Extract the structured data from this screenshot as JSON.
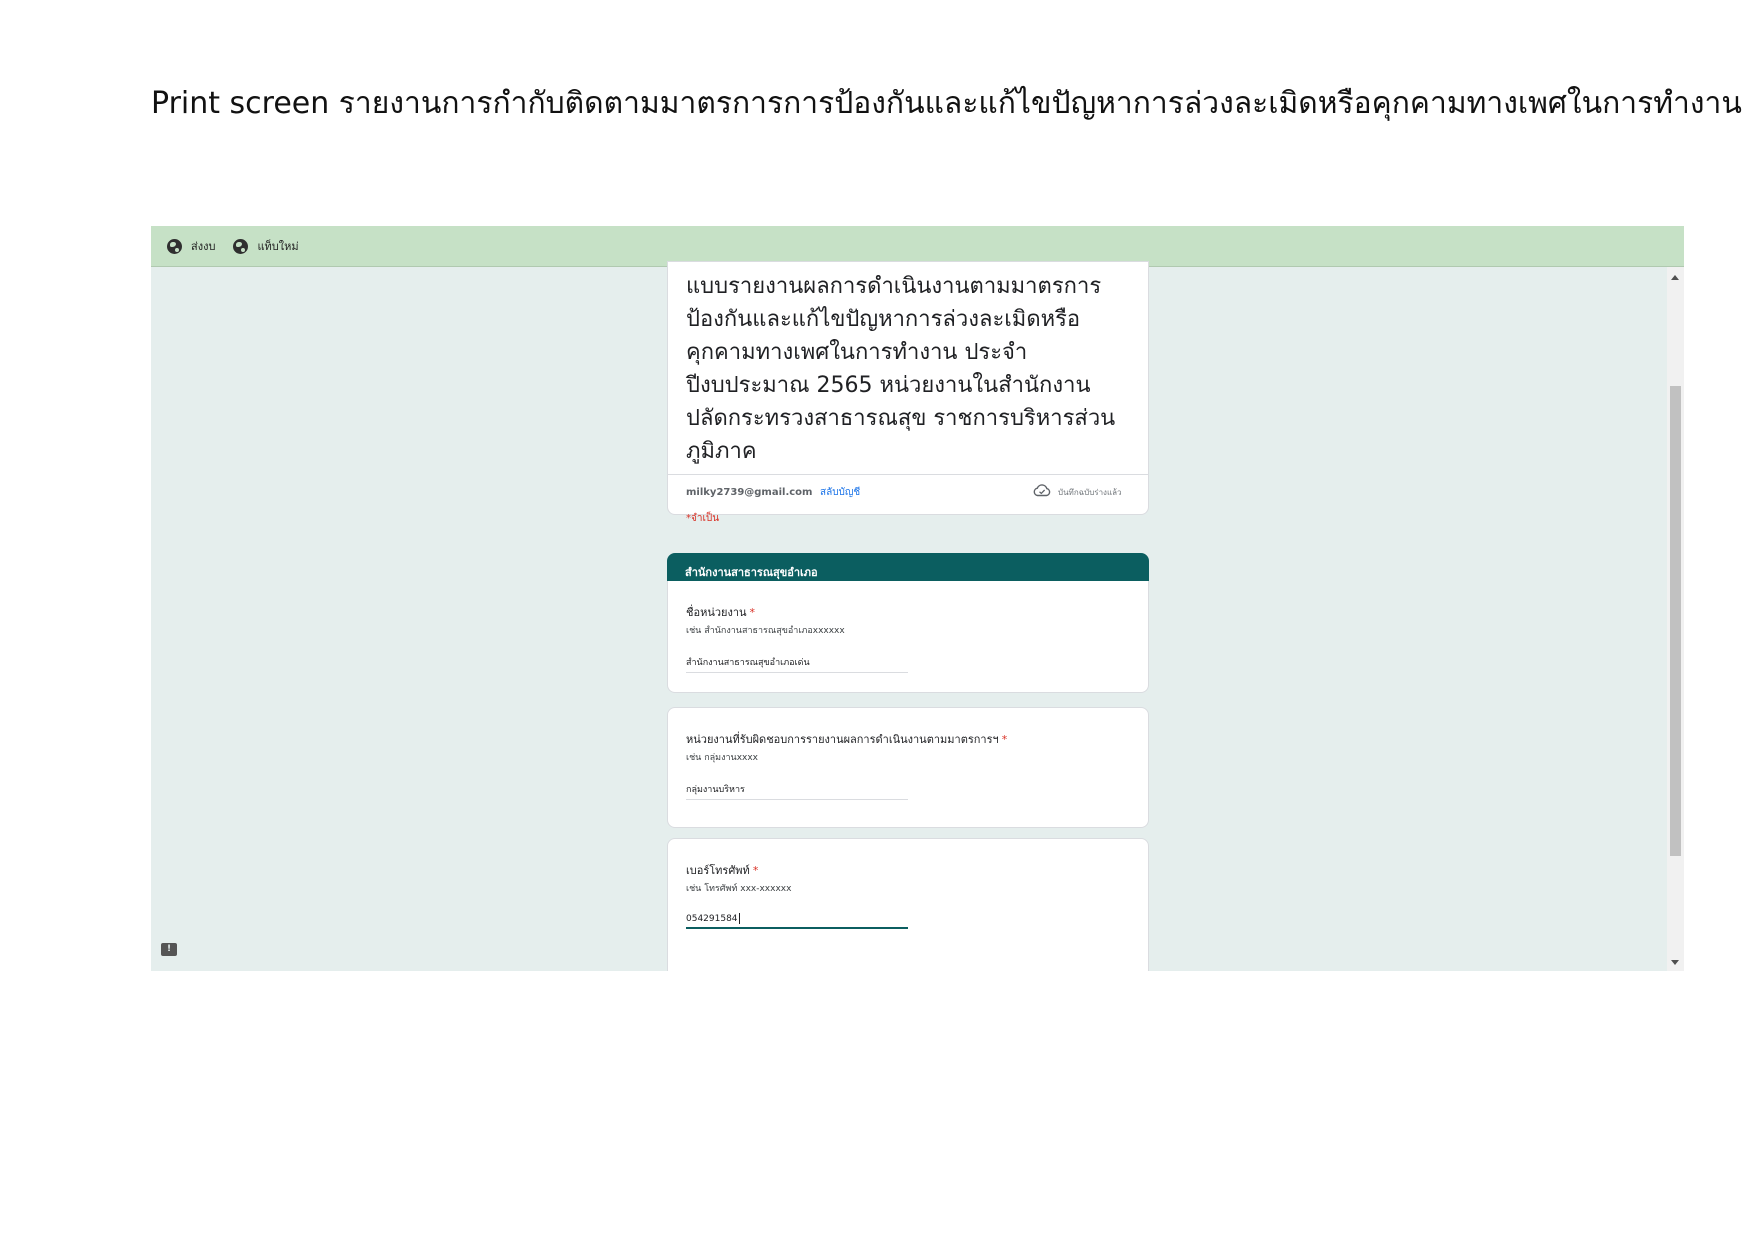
{
  "document": {
    "heading": "Print screen รายงานการกำกับติดตามมาตรการการป้องกันและแก้ไขปัญหาการล่วงละเมิดหรือคุกคามทางเพศในการทำงาน"
  },
  "toolbar": {
    "bookmarks": [
      {
        "label": "ส่งงบ",
        "icon": "globe-icon"
      },
      {
        "label": "แท็บใหม่",
        "icon": "globe-icon"
      }
    ],
    "bar_color": "#c6e1c6"
  },
  "form": {
    "title": "แบบรายงานผลการดำเนินงานตามมาตรการป้องกันและแก้ไขปัญหาการล่วงละเมิดหรือคุกคามทางเพศในการทำงาน ประจำปีงบประมาณ 2565 หน่วยงานในสำนักงานปลัดกระทรวงสาธารณสุข ราชการบริหารส่วนภูมิภาค",
    "account_email": "milky2739@gmail.com",
    "switch_account": "สลับบัญชี",
    "saved_status": "บันทึกฉบับร่างแล้ว",
    "required_note": "*จำเป็น",
    "section_title": "สำนักงานสาธารณสุขอำเภอ",
    "accent_color": "#0b5e60",
    "questions": [
      {
        "label": "ชื่อหน่วยงาน",
        "required_mark": "*",
        "help": "เช่น สำนักงานสาธารณสุขอำเภอxxxxxx",
        "answer": "สำนักงานสาธารณสุขอำเภอเด่น"
      },
      {
        "label": "หน่วยงานที่รับผิดชอบการรายงานผลการดำเนินงานตามมาตรการฯ",
        "required_mark": "*",
        "help": "เช่น กลุ่มงานxxxx",
        "answer": "กลุ่มงานบริหาร"
      },
      {
        "label": "เบอร์โทรศัพท์",
        "required_mark": "*",
        "help": "เช่น โทรศัพท์ xxx-xxxxxx",
        "answer": "054291584"
      }
    ]
  }
}
